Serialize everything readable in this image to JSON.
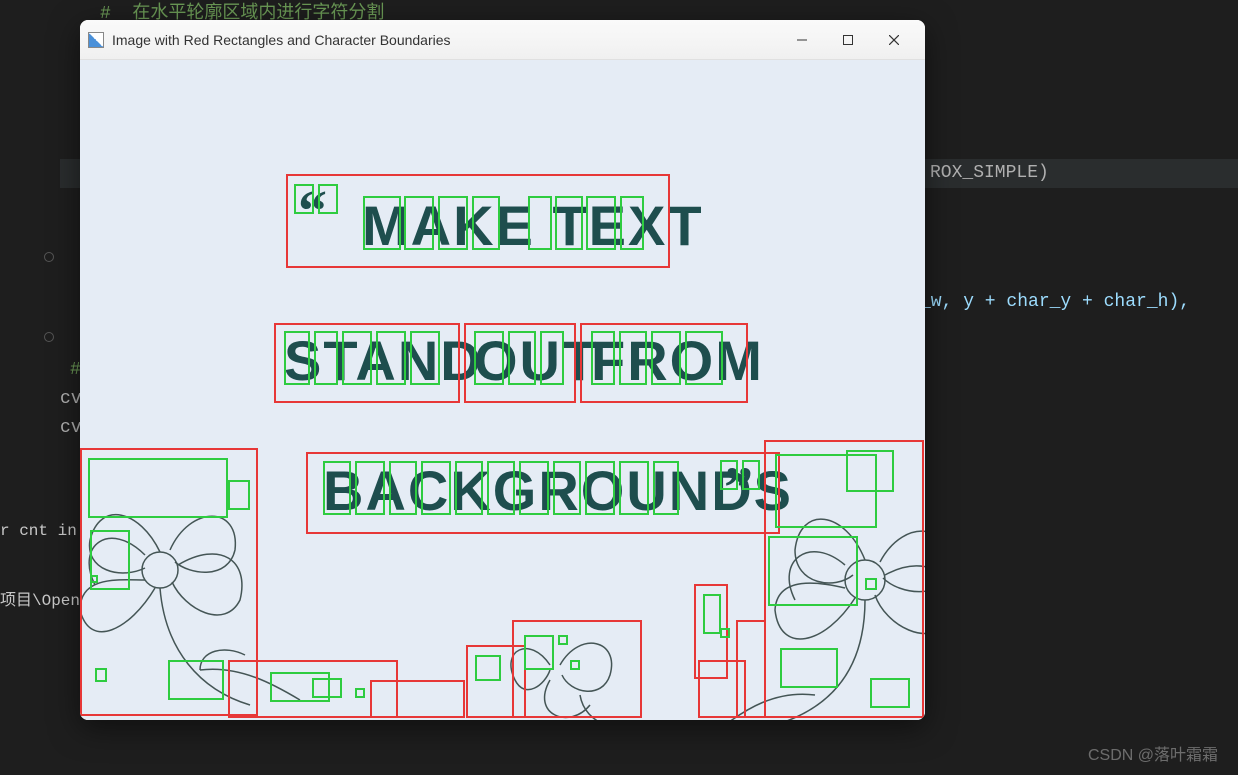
{
  "code": {
    "comment1": "#  在水平轮廓区域内进行字符分割",
    "line1_tail": "ROX_SIMPLE)",
    "line2_tail": "_w, y + char_y + char_h),",
    "comment2": "# ",
    "cv_prefix": "cv",
    "left_snippet": "r cnt in ho",
    "path_snippet": "项目\\Open"
  },
  "window": {
    "title": "Image with Red Rectangles and Character Boundaries",
    "image_text": {
      "quote_open": "“",
      "line1": "MAKE TEXT",
      "line2_w1": "STAND",
      "line2_w2": "OUT",
      "line2_w3": "FROM",
      "line3": "BACKGROUNDS",
      "quote_close": "”"
    }
  },
  "watermark": "CSDN @落叶霜霜"
}
